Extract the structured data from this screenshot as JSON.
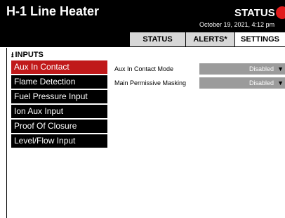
{
  "header": {
    "title": "H-1 Line Heater",
    "status_label": "STATUS",
    "datetime": "October 19, 2021, 4:12 pm",
    "status_color": "#e01b1b"
  },
  "tabs": [
    {
      "label": "STATUS",
      "active": false
    },
    {
      "label": "ALERTS*",
      "active": false
    },
    {
      "label": "SETTINGS",
      "active": true
    }
  ],
  "section": {
    "icon": "download-arrow-icon",
    "title": "INPUTS"
  },
  "side_menu": {
    "items": [
      {
        "label": "Aux In Contact",
        "active": true
      },
      {
        "label": "Flame Detection",
        "active": false
      },
      {
        "label": "Fuel Pressure Input",
        "active": false
      },
      {
        "label": "Ion Aux Input",
        "active": false
      },
      {
        "label": "Proof Of Closure",
        "active": false
      },
      {
        "label": "Level/Flow Input",
        "active": false
      }
    ]
  },
  "fields": [
    {
      "label": "Aux In Contact Mode",
      "value": "Disabled"
    },
    {
      "label": "Main Permissive Masking",
      "value": "Disabled"
    }
  ],
  "colors": {
    "header_bg": "#000000",
    "active_menu": "#c0191a",
    "select_bg": "#9b9b9b",
    "tab_bg": "#d7d7d7"
  }
}
